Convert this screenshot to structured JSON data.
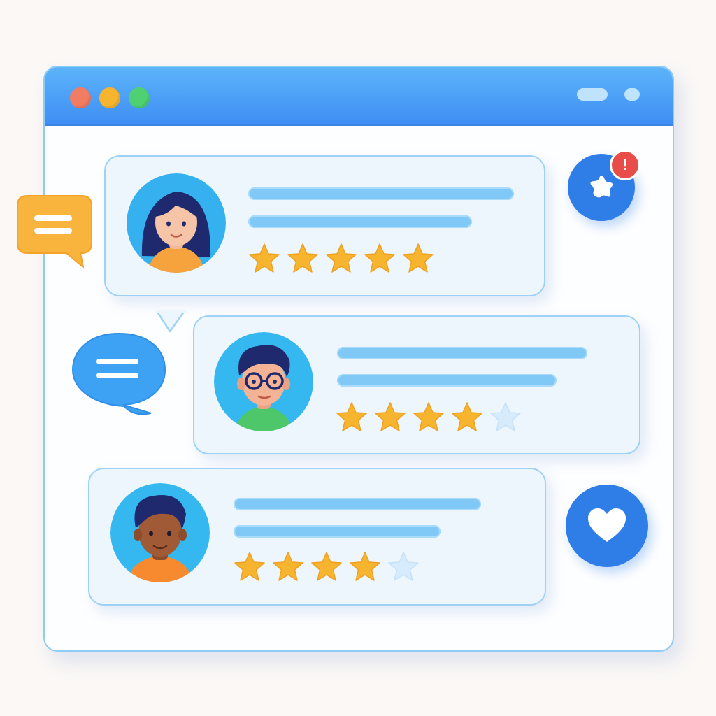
{
  "window": {
    "titlebar_color": "#4a9ef7",
    "controls": [
      "close-dot",
      "minimize-dot",
      "maximize-dot"
    ]
  },
  "colors": {
    "card_background": "#edf6fd",
    "card_border": "#9dd2f6",
    "text_placeholder": "#80c8f5",
    "star_filled": "#f7b52f",
    "star_empty": "#d6ebfb",
    "badge_blue": "#2f7ee8",
    "notification_red": "#e84d49",
    "chat_yellow": "#f9b43d",
    "chat_blue": "#3da2f3"
  },
  "notification": {
    "count": "!"
  },
  "reviews": [
    {
      "avatar": "woman-avatar",
      "rating": 5,
      "max_rating": 5
    },
    {
      "avatar": "man-glasses-avatar",
      "rating": 4,
      "max_rating": 5
    },
    {
      "avatar": "man-avatar",
      "rating": 4,
      "max_rating": 5
    }
  ],
  "icons": {
    "notification_badge": "star-badge-icon",
    "favorite_badge": "heart-icon",
    "chat_left": "chat-bubble-icon",
    "chat_middle": "chat-bubble-icon"
  }
}
